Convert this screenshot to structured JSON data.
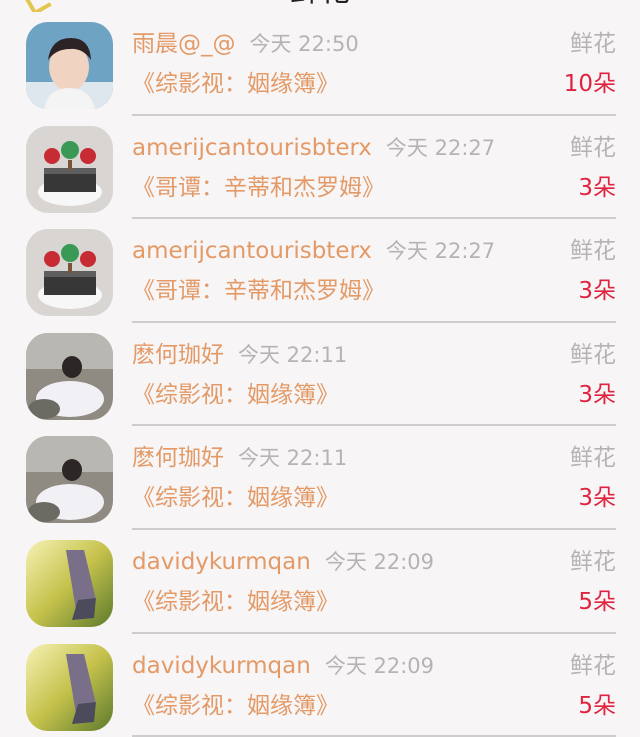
{
  "header": {
    "title": "鲜花"
  },
  "rows": [
    {
      "username": "雨晨@_@",
      "time": "今天 22:50",
      "label": "鲜花",
      "book": "《综影视：姻缘簿》",
      "count": "10朵",
      "avatar": "young-man-avatar"
    },
    {
      "username": "amerijcantourisbterx",
      "time": "今天 22:27",
      "label": "鲜花",
      "book": "《哥谭：辛蒂和杰罗姆》",
      "count": "3朵",
      "avatar": "cake-avatar"
    },
    {
      "username": "amerijcantourisbterx",
      "time": "今天 22:27",
      "label": "鲜花",
      "book": "《哥谭：辛蒂和杰罗姆》",
      "count": "3朵",
      "avatar": "cake-avatar"
    },
    {
      "username": "麽何珈好",
      "time": "今天 22:11",
      "label": "鲜花",
      "book": "《综影视：姻缘簿》",
      "count": "3朵",
      "avatar": "white-dress-girl-avatar"
    },
    {
      "username": "麽何珈好",
      "time": "今天 22:11",
      "label": "鲜花",
      "book": "《综影视：姻缘簿》",
      "count": "3朵",
      "avatar": "white-dress-girl-avatar"
    },
    {
      "username": "davidykurmqan",
      "time": "今天 22:09",
      "label": "鲜花",
      "book": "《综影视：姻缘簿》",
      "count": "5朵",
      "avatar": "sunlit-field-avatar"
    },
    {
      "username": "davidykurmqan",
      "time": "今天 22:09",
      "label": "鲜花",
      "book": "《综影视：姻缘簿》",
      "count": "5朵",
      "avatar": "sunlit-field-avatar"
    }
  ],
  "colors": {
    "username": "#e39a67",
    "book": "#e39a67",
    "time": "#b6b3b4",
    "count": "#e0233f",
    "divider": "#cfcccd",
    "background": "#f7f5f6"
  }
}
